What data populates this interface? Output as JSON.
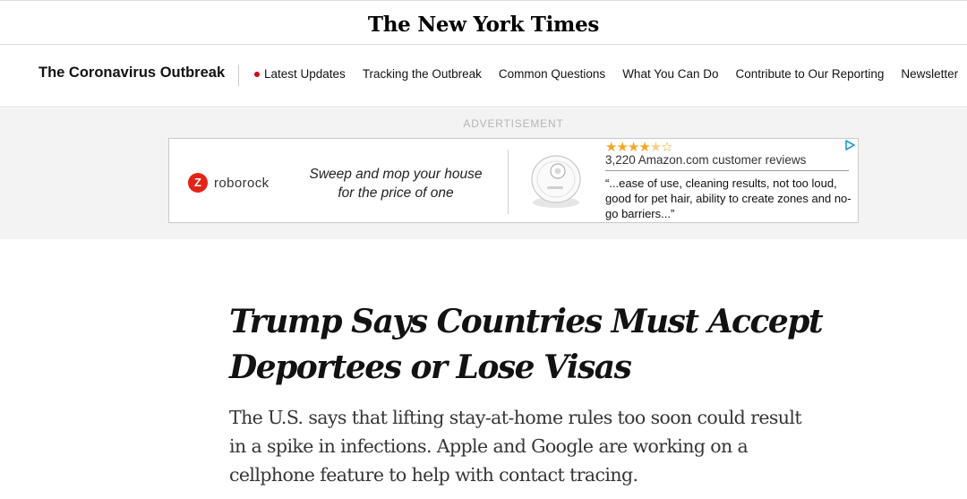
{
  "masthead": {
    "logo_text": "The New York Times"
  },
  "nav": {
    "section_title": "The Coronavirus Outbreak",
    "links": [
      {
        "label": "Latest Updates",
        "live": true
      },
      {
        "label": "Tracking the Outbreak"
      },
      {
        "label": "Common Questions"
      },
      {
        "label": "What You Can Do"
      },
      {
        "label": "Contribute to Our Reporting"
      },
      {
        "label": "Newsletter"
      }
    ]
  },
  "ad": {
    "label": "ADVERTISEMENT",
    "brand_mark": "Z",
    "brand_name": "roborock",
    "slogan_line1": "Sweep and mop your house",
    "slogan_line2": "for the price of one",
    "stars": "★★★★",
    "star_half": "★",
    "star_empty": "☆",
    "review_count": "3,220 Amazon.com customer reviews",
    "review_quote": "“...ease of use, cleaning results, not too loud, good for pet hair, ability to create zones and no-go barriers...”",
    "brand_color": "#e2231a",
    "adchoices_icon": "adchoices-icon"
  },
  "article": {
    "headline_line1": "Trump Says Countries Must Accept",
    "headline_line2": "Deportees or Lose Visas",
    "summary": "The U.S. says that lifting stay-at-home rules too soon could result in a spike in infections. Apple and Google are working on a cellphone feature to help with contact tracing."
  }
}
